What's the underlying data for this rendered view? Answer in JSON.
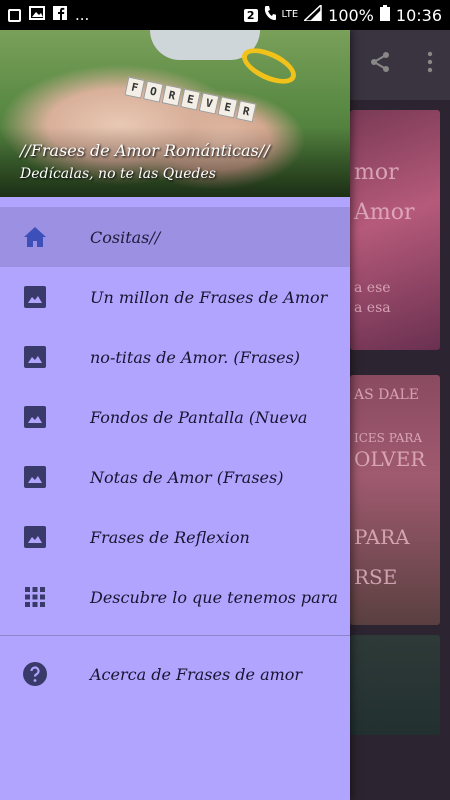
{
  "status_bar": {
    "notif_dots": "...",
    "sim_badge": "2",
    "network": "LTE",
    "battery": "100%",
    "time": "10:36"
  },
  "drawer": {
    "header": {
      "title": "//Frases de Amor Románticas//",
      "subtitle": "Dedícalas, no te las Quedes",
      "tiles": [
        "F",
        "O",
        "R",
        "E",
        "V",
        "E",
        "R"
      ]
    },
    "items": [
      {
        "label": "Cositas//",
        "icon": "home-icon",
        "active": true
      },
      {
        "label": "Un millon de Frases de Amor",
        "icon": "image-icon"
      },
      {
        "label": "no-titas de Amor. (Frases)",
        "icon": "image-icon"
      },
      {
        "label": "Fondos de Pantalla (Nueva",
        "icon": "image-icon"
      },
      {
        "label": "Notas de Amor (Frases)",
        "icon": "image-icon"
      },
      {
        "label": "Frases de Reflexion",
        "icon": "image-icon"
      },
      {
        "label": "Descubre lo que tenemos para",
        "icon": "apps-grid-icon"
      }
    ],
    "footer_item": {
      "label": "Acerca de Frases de amor",
      "icon": "help-circle-icon"
    }
  },
  "background_app": {
    "card1_text": [
      "mor",
      "Amor",
      "a ese",
      "a esa"
    ],
    "card2_text": [
      "AS DALE",
      "ICES PARA",
      "OLVER",
      "PARA",
      "RSE"
    ]
  },
  "colors": {
    "drawer_bg": "#b1a4ff",
    "active_bg": "#9c90e2",
    "icon": "#3a3a6a",
    "active_icon": "#3d4fb8"
  }
}
